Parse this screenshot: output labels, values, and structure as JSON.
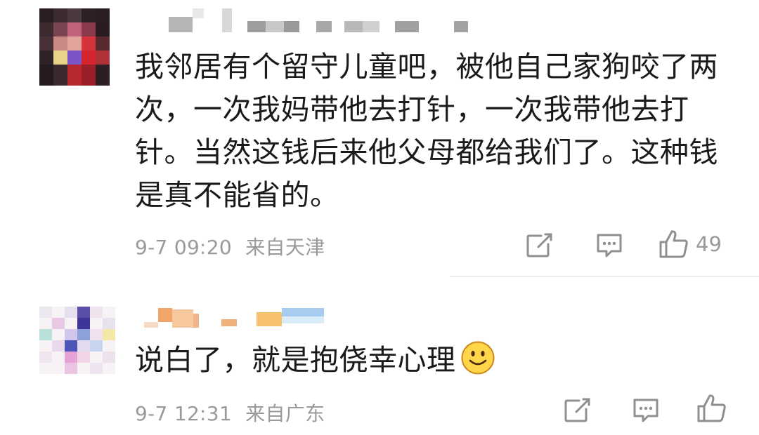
{
  "comments": [
    {
      "text": "我邻居有个留守儿童吧，被他自己家狗咬了两次，一次我妈带他去打针，一次我带他去打针。当然这钱后来他父母都给我们了。这种钱是真不能省的。",
      "lines": [
        "我邻居有个留守儿童吧，被他自己家狗咬了两",
        "次，一次我妈带他去打针，一次我带他去打",
        "针。当然这钱后来他父母都给我们了。这种钱",
        "是真不能省的。"
      ],
      "timestamp": "9-7 09:20",
      "location": "来自天津",
      "likes": "49",
      "icons": {
        "share": "share-icon",
        "reply": "comment-icon",
        "like": "thumbs-up-icon"
      }
    },
    {
      "text": "说白了，就是抱侥幸心理",
      "timestamp": "9-7 12:31",
      "location": "来自广东",
      "likes": "",
      "emoji": "smiley-emoji",
      "icons": {
        "share": "share-icon",
        "reply": "comment-icon",
        "like": "thumbs-up-icon"
      }
    }
  ],
  "colors": {
    "text": "#1a1a1a",
    "meta": "#9a9a9a",
    "icon": "#8f8f8f",
    "divider": "#ececec",
    "emoji_fill": "#ffd54a"
  }
}
